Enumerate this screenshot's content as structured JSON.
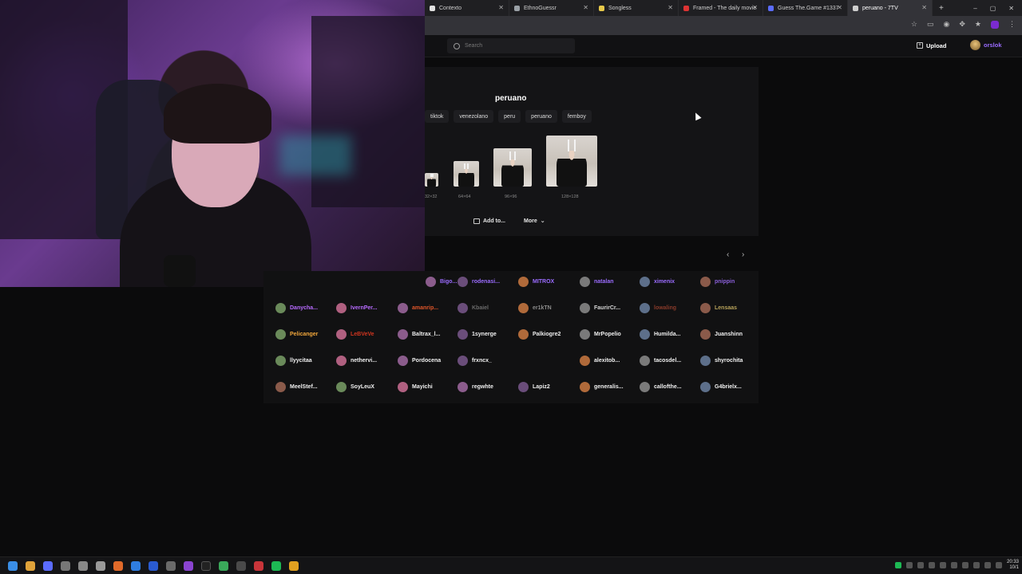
{
  "browser": {
    "tabs": [
      {
        "title": "Contexto",
        "favicon_color": "#e0e0e0",
        "active": false
      },
      {
        "title": "EthnoGuessr",
        "favicon_color": "#9aa0a6",
        "active": false
      },
      {
        "title": "Songless",
        "favicon_color": "#e7c94a",
        "active": false
      },
      {
        "title": "Framed - The daily movie",
        "favicon_color": "#d33",
        "active": false
      },
      {
        "title": "Guess The.Game #1337",
        "favicon_color": "#5b6cff",
        "active": false
      },
      {
        "title": "peruano - 7TV",
        "favicon_color": "#cfcfcf",
        "active": true
      }
    ],
    "new_tab": "+",
    "window_controls": [
      "–",
      "▢",
      "✕"
    ]
  },
  "header": {
    "search_placeholder": "Search",
    "upload_label": "Upload",
    "username": "orslok"
  },
  "emote": {
    "name": "peruano",
    "tags": [
      "tiktok",
      "venezolano",
      "peru",
      "peruano",
      "femboy"
    ],
    "sizes": [
      "32×32",
      "64×64",
      "96×96",
      "128×128"
    ],
    "add_to_label": "Add to...",
    "more_label": "More"
  },
  "pager": {
    "prev": "‹",
    "next": "›"
  },
  "users": [
    {
      "name": "Bigo...",
      "color": "#9b6cff"
    },
    {
      "name": "rodenasi...",
      "color": "#9b6cff"
    },
    {
      "name": "MITROX",
      "color": "#9b6cff"
    },
    {
      "name": "natalan",
      "color": "#9b6cff"
    },
    {
      "name": "ximenix",
      "color": "#9b6cff"
    },
    {
      "name": "pnippin",
      "color": "#8a5fd9"
    },
    {
      "name": "Danycha...",
      "color": "#b86bff"
    },
    {
      "name": "IvernPer...",
      "color": "#b86bff"
    },
    {
      "name": "amanrip...",
      "color": "#e0562a"
    },
    {
      "name": "Kbaiel",
      "color": "#6b6b6b"
    },
    {
      "name": "er1kTN",
      "color": "#8b8b8b"
    },
    {
      "name": "FaurirCr...",
      "color": "#d6d6d6"
    },
    {
      "name": "lowaling",
      "color": "#8a3b2a"
    },
    {
      "name": "Lensaas",
      "color": "#b7a25a"
    },
    {
      "name": "Pelicanger",
      "color": "#f2a73b"
    },
    {
      "name": "LeBVeVe",
      "color": "#d0351f"
    },
    {
      "name": "Baltrax_l...",
      "color": "#f0f0f0"
    },
    {
      "name": "1synerge",
      "color": "#f0f0f0"
    },
    {
      "name": "Palkiogre2",
      "color": "#f0f0f0"
    },
    {
      "name": "MrPopelio",
      "color": "#f0f0f0"
    },
    {
      "name": "Humilda...",
      "color": "#f0f0f0"
    },
    {
      "name": "Juanshinn",
      "color": "#f0f0f0"
    },
    {
      "name": "llyycitaa",
      "color": "#f0f0f0"
    },
    {
      "name": "nethervi...",
      "color": "#f0f0f0"
    },
    {
      "name": "Pordocena",
      "color": "#f0f0f0"
    },
    {
      "name": "frxncx_",
      "color": "#f0f0f0"
    },
    {
      "name": "alexitob...",
      "color": "#f0f0f0"
    },
    {
      "name": "tacosdel...",
      "color": "#f0f0f0"
    },
    {
      "name": "shyrochita",
      "color": "#f0f0f0"
    },
    {
      "name": "MeelStef...",
      "color": "#f0f0f0"
    },
    {
      "name": "SoyLeuX",
      "color": "#f0f0f0"
    },
    {
      "name": "Mayichi",
      "color": "#f0f0f0"
    },
    {
      "name": "regwhte",
      "color": "#f0f0f0"
    },
    {
      "name": "Lapiz2",
      "color": "#f0f0f0"
    },
    {
      "name": "generalis...",
      "color": "#f0f0f0"
    },
    {
      "name": "callofthe...",
      "color": "#f0f0f0"
    },
    {
      "name": "G4brielx...",
      "color": "#f0f0f0"
    }
  ],
  "taskbar": {
    "clock_time": "20:33",
    "clock_date": "10/1"
  }
}
